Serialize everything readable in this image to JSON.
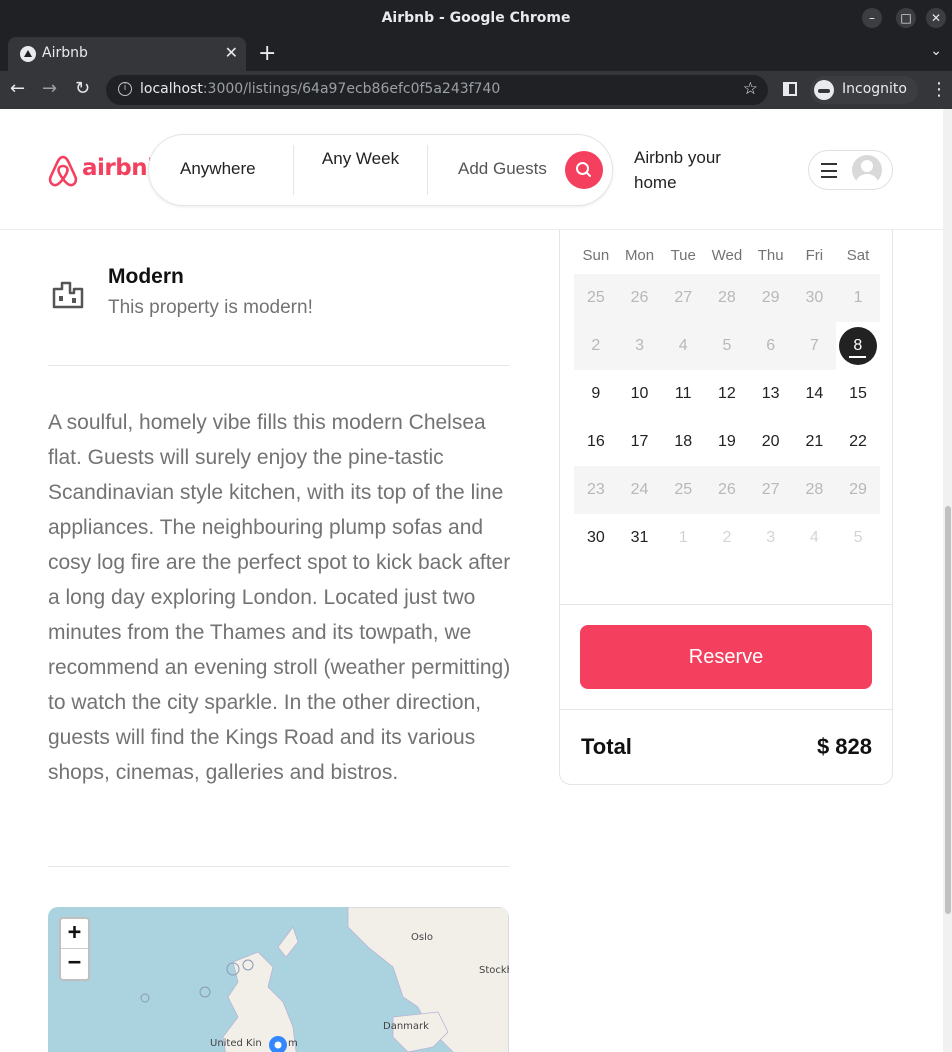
{
  "window": {
    "title": "Airbnb - Google Chrome",
    "minimize": "–",
    "maximize": "□",
    "close": "✕"
  },
  "tab": {
    "label": "Airbnb",
    "close": "✕",
    "new_tab": "+"
  },
  "address_bar": {
    "host": "localhost",
    "path": ":3000/listings/64a97ecb86efc0f5a243f740",
    "info_icon": "i",
    "bookmark_icon": "☆"
  },
  "incognito_label": "Incognito",
  "header": {
    "logo_text": "airbnb",
    "search": {
      "anywhere": "Anywhere",
      "any_week": "Any Week",
      "add_guests": "Add Guests"
    },
    "host_link": "Airbnb your home"
  },
  "listing": {
    "feature_title": "Modern",
    "feature_subtitle": "This property is modern!",
    "description": "A soulful, homely vibe fills this modern Chelsea flat. Guests will surely enjoy the pine-tastic Scandinavian style kitchen, with its top of the line appliances. The neighbouring plump sofas and cosy log fire are the perfect spot to kick back after a long day exploring London. Located just two minutes from the Thames and its towpath, we recommend an evening stroll (weather permitting) to watch the city sparkle. In the other direction, guests will find the Kings Road and its various shops, cinemas, galleries and bistros."
  },
  "map": {
    "zoom_in": "+",
    "zoom_out": "−",
    "labels": {
      "oslo": "Oslo",
      "stockholm": "Stockh",
      "danmark": "Danmark",
      "uk": "United Kin",
      "uk_tail": "m"
    }
  },
  "calendar": {
    "weekdays": [
      "Sun",
      "Mon",
      "Tue",
      "Wed",
      "Thu",
      "Fri",
      "Sat"
    ],
    "weeks": [
      [
        "25",
        "26",
        "27",
        "28",
        "29",
        "30",
        "1"
      ],
      [
        "2",
        "3",
        "4",
        "5",
        "6",
        "7",
        "8"
      ],
      [
        "9",
        "10",
        "11",
        "12",
        "13",
        "14",
        "15"
      ],
      [
        "16",
        "17",
        "18",
        "19",
        "20",
        "21",
        "22"
      ],
      [
        "23",
        "24",
        "25",
        "26",
        "27",
        "28",
        "29"
      ],
      [
        "30",
        "31",
        "1",
        "2",
        "3",
        "4",
        "5"
      ]
    ],
    "selected_day": "8"
  },
  "reservation": {
    "reserve_label": "Reserve",
    "total_label": "Total",
    "total_value": "$ 828"
  },
  "colors": {
    "brand": "#f43f5e",
    "text_muted": "#737373",
    "chrome_dark": "#202124"
  }
}
